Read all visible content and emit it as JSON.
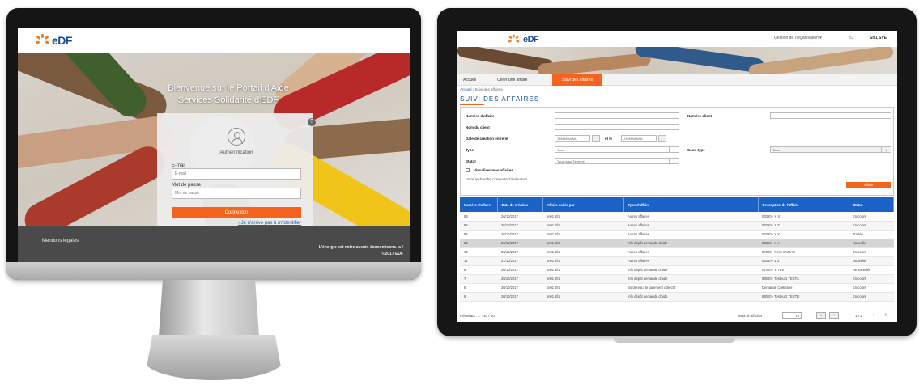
{
  "brand": {
    "name": "EDF",
    "accent": "#f4641c",
    "primary": "#1a4b9b",
    "table_header": "#1a62c6"
  },
  "login_page": {
    "title_line1": "Bienvenue sur le Portail d'Aide",
    "title_line2": "Services Solidarité d'EDF",
    "help_icon": "?",
    "auth_title": "Authentification",
    "email_label": "E-mail",
    "email_placeholder": "E-mail",
    "password_label": "Mot de passe",
    "password_placeholder": "Mot de passe",
    "submit_label": "Connexion",
    "forgot_link": "› Je n'arrive pas à m'identifier",
    "footer_left": "Mentions légales",
    "footer_slogan": "L'énergie est notre avenir, économisons-la !",
    "footer_copyright": "©2017 EDF"
  },
  "app_page": {
    "org_menu": "Gestion de l'organisation",
    "user_name": "SN1 SVE",
    "nav": [
      "Accueil",
      "Créer une affaire",
      "Suivi des affaires"
    ],
    "breadcrumb_home": "Accueil",
    "breadcrumb_sep": "›",
    "breadcrumb_current": "Suivi des affaires",
    "title": "SUIVI DES AFFAIRES",
    "form": {
      "numero_affaire": "Numéro d'affaire",
      "numero_client": "Numéro client",
      "nom_client": "Nom du client",
      "date_creation": "Date de création entre le",
      "et_le": "et le",
      "date_placeholder": "JJ/MM/AAAA",
      "type": "Type",
      "type_value": "Tous",
      "sous_type": "Sous-type",
      "sous_type_value": "Tous",
      "statut": "Statut",
      "statut_value": "Tous (sauf Terminé)",
      "mes_affaires": "Visualiser mes affaires",
      "result_text": "Votre recherche comporte 10 résultats.",
      "filter_button": "Filtrer"
    },
    "table": {
      "headers": [
        "Numéro d'affaire",
        "Date de création",
        "Affaire suivie par",
        "Type d'affaire",
        "Description de l'affaire",
        "Statut"
      ],
      "rows": [
        [
          "96",
          "26/10/2017",
          "sn01 sfr1",
          "Autres affaires",
          "03360 - X X",
          "En cours"
        ],
        [
          "95",
          "26/10/2017",
          "sn01 sfr1",
          "Autres affaires",
          "03360 - Z Z",
          "En cours"
        ],
        [
          "94",
          "26/10/2017",
          "sn01 sfr1",
          "Autres affaires",
          "03360 - Y Y",
          "Traitée"
        ],
        [
          "92",
          "26/10/2017",
          "sn01 sfr1",
          "Info dépôt demande d'aide",
          "03360 - X A",
          "Nouvelle"
        ],
        [
          "10",
          "26/10/2017",
          "sn01 sfr1",
          "Autres affaires",
          "07000 - Rose DURAS",
          "En cours"
        ],
        [
          "11",
          "21/10/2017",
          "sn01 sfr1",
          "Autres affaires",
          "03360 - Z Z",
          "Nouvelle"
        ],
        [
          "8",
          "20/10/2017",
          "sn01 sfr1",
          "Info dépôt demande d'aide",
          "07000 - Y TEST",
          "Renouvelée"
        ],
        [
          "7",
          "20/10/2017",
          "sn01 sfr1",
          "Info dépôt demande d'aide",
          "93000 - Testeur1 TESTA",
          "En cours"
        ],
        [
          "6",
          "20/10/2017",
          "sn01 sfr1",
          "Bordereau de paiement collectif",
          "Demande Collective",
          "En cours"
        ],
        [
          "5",
          "20/10/2017",
          "sn01 sfr1",
          "Info dépôt demande d'aide",
          "93000 - Testeur2 TESTB",
          "En cours"
        ]
      ]
    },
    "pagination": {
      "results": "Résultats : 1 - 10 / 10",
      "max_label": "Max. à afficher :",
      "max_value": "10",
      "page": "1 / 2",
      "next": "›",
      "last": "»"
    }
  }
}
